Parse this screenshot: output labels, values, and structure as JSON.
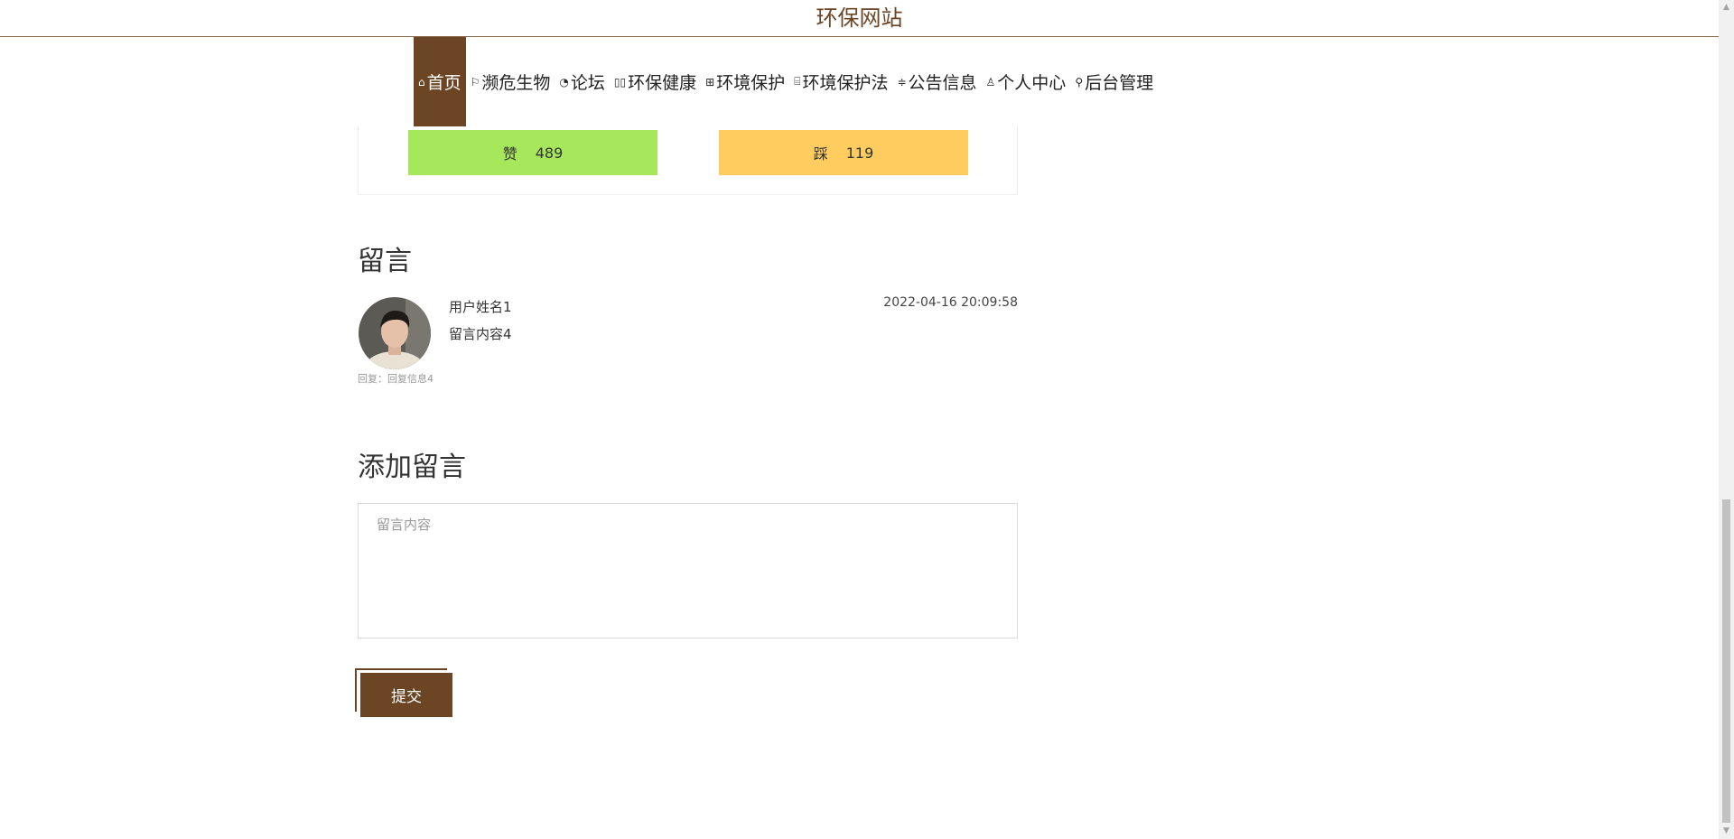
{
  "site": {
    "title": "环保网站"
  },
  "nav": [
    {
      "icon": "home-icon",
      "glyph": "⌂",
      "label": "首页",
      "active": true
    },
    {
      "icon": "flag-icon",
      "glyph": "⚐",
      "label": "濒危生物"
    },
    {
      "icon": "gauge-icon",
      "glyph": "◔",
      "label": "论坛"
    },
    {
      "icon": "columns-icon",
      "glyph": "▯▯",
      "label": "环保健康"
    },
    {
      "icon": "grid-icon",
      "glyph": "⊞",
      "label": "环境保护"
    },
    {
      "icon": "building-icon",
      "glyph": "⌸",
      "label": "环境保护法"
    },
    {
      "icon": "sliders-icon",
      "glyph": "≑",
      "label": "公告信息"
    },
    {
      "icon": "user-icon",
      "glyph": "♙",
      "label": "个人中心"
    },
    {
      "icon": "link-icon",
      "glyph": "⚲",
      "label": "后台管理"
    }
  ],
  "votes": {
    "like_label": "赞",
    "like_count": "489",
    "dislike_label": "踩",
    "dislike_count": "119",
    "like_color": "#a6e75c",
    "dislike_color": "#ffcd5f"
  },
  "comments": {
    "heading": "留言",
    "items": [
      {
        "username": "用户姓名1",
        "content": "留言内容4",
        "time": "2022-04-16 20:09:58",
        "reply": "回复：回复信息4"
      }
    ]
  },
  "add_comment": {
    "heading": "添加留言",
    "placeholder": "留言内容",
    "submit_label": "提交"
  },
  "colors": {
    "brand": "#6b4524"
  }
}
